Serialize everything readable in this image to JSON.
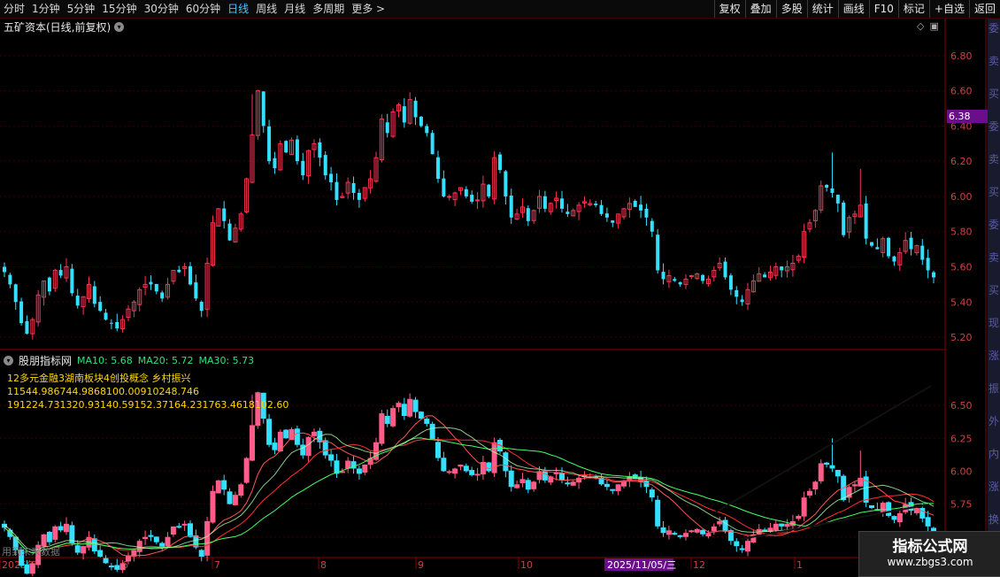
{
  "toolbar": {
    "left_items": [
      "分时",
      "1分钟",
      "5分钟",
      "15分钟",
      "30分钟",
      "60分钟",
      "日线",
      "周线",
      "月线",
      "多周期",
      "更多 >"
    ],
    "active": "日线",
    "right_items": [
      "复权",
      "叠加",
      "多股",
      "统计",
      "画线",
      "F10",
      "标记",
      "+自选",
      "返回"
    ]
  },
  "main_chart": {
    "title": "五矿资本(日线,前复权)",
    "price_label": "6.38",
    "y_ticks": [
      "6.80",
      "6.60",
      "6.40",
      "6.20",
      "6.00",
      "5.80",
      "5.60",
      "5.40",
      "5.20"
    ]
  },
  "indicator": {
    "name": "股朋指标网",
    "ma10": "MA10: 5.68",
    "ma20": "MA20: 5.72",
    "ma30": "MA30: 5.73",
    "lines": [
      "12多元金融3湖南板块4创投概念 乡村振兴",
      "11544.986744.9868100.00910248.746",
      "191224.731320.93140.59152.37164.231763.4618102.60"
    ],
    "y_ticks": [
      "6.50",
      "6.25",
      "6.00",
      "5.75",
      "5.50"
    ]
  },
  "x_axis": {
    "labels": [
      "2025年",
      "6",
      "7",
      "8",
      "9",
      "10",
      "2025/11/05/三",
      "12",
      "1"
    ],
    "watermark": "用到未来数据"
  },
  "right_strip_chars": [
    "委",
    "卖",
    "买",
    "委",
    "卖",
    "买",
    "委",
    "卖",
    "买",
    "现",
    "涨",
    "振",
    "外",
    "内",
    "涨",
    "换"
  ],
  "logo": {
    "main": "指标公式网",
    "url": "www.zbgs3.com"
  },
  "colors": {
    "up": "#ff3355",
    "up_ind": "#ff5c8a",
    "down": "#33e0ff",
    "grid": "#3a0000",
    "accent": "#6a0e8c"
  },
  "chart_data": {
    "type": "candlestick",
    "main_ylim": [
      5.15,
      6.95
    ],
    "indicator_ylim": [
      5.35,
      6.75
    ],
    "close_series": [
      5.57,
      5.5,
      5.4,
      5.28,
      5.22,
      5.3,
      5.44,
      5.52,
      5.46,
      5.58,
      5.55,
      5.6,
      5.45,
      5.38,
      5.43,
      5.5,
      5.39,
      5.35,
      5.3,
      5.28,
      5.25,
      5.3,
      5.36,
      5.4,
      5.47,
      5.5,
      5.5,
      5.46,
      5.42,
      5.5,
      5.58,
      5.57,
      5.6,
      5.5,
      5.42,
      5.35,
      5.62,
      5.85,
      5.93,
      5.86,
      5.75,
      5.82,
      5.9,
      6.1,
      6.35,
      6.6,
      6.4,
      6.2,
      6.16,
      6.3,
      6.25,
      6.32,
      6.2,
      6.12,
      6.26,
      6.3,
      6.22,
      6.12,
      6.08,
      5.98,
      6.0,
      6.08,
      6.02,
      5.98,
      6.05,
      6.1,
      6.22,
      6.44,
      6.36,
      6.48,
      6.52,
      6.42,
      6.55,
      6.45,
      6.4,
      6.36,
      6.24,
      6.1,
      6.0,
      6.0,
      6.02,
      6.05,
      6.0,
      5.97,
      5.98,
      6.07,
      6.0,
      6.22,
      6.15,
      6.0,
      5.88,
      5.9,
      5.94,
      5.86,
      5.92,
      6.0,
      5.93,
      5.96,
      5.99,
      5.93,
      5.9,
      5.92,
      5.95,
      5.97,
      5.96,
      5.95,
      5.9,
      5.88,
      5.85,
      5.9,
      5.93,
      5.96,
      5.94,
      5.92,
      5.88,
      5.8,
      5.58,
      5.53,
      5.55,
      5.52,
      5.5,
      5.53,
      5.55,
      5.56,
      5.52,
      5.53,
      5.58,
      5.62,
      5.54,
      5.47,
      5.43,
      5.4,
      5.47,
      5.52,
      5.56,
      5.54,
      5.57,
      5.6,
      5.58,
      5.6,
      5.62,
      5.66,
      5.8,
      5.85,
      5.92,
      6.06,
      6.05,
      6.02,
      5.96,
      5.78,
      5.88,
      5.9,
      5.95,
      5.76,
      5.72,
      5.7,
      5.76,
      5.66,
      5.63,
      5.68,
      5.75,
      5.7,
      5.72,
      5.64,
      5.58,
      5.54
    ]
  }
}
